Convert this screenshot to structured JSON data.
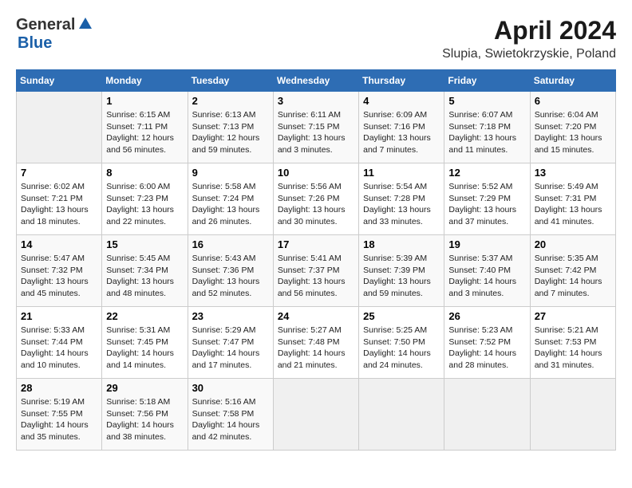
{
  "header": {
    "logo_general": "General",
    "logo_blue": "Blue",
    "title": "April 2024",
    "subtitle": "Slupia, Swietokrzyskie, Poland"
  },
  "calendar": {
    "days_of_week": [
      "Sunday",
      "Monday",
      "Tuesday",
      "Wednesday",
      "Thursday",
      "Friday",
      "Saturday"
    ],
    "weeks": [
      [
        {
          "day": "",
          "info": ""
        },
        {
          "day": "1",
          "info": "Sunrise: 6:15 AM\nSunset: 7:11 PM\nDaylight: 12 hours\nand 56 minutes."
        },
        {
          "day": "2",
          "info": "Sunrise: 6:13 AM\nSunset: 7:13 PM\nDaylight: 12 hours\nand 59 minutes."
        },
        {
          "day": "3",
          "info": "Sunrise: 6:11 AM\nSunset: 7:15 PM\nDaylight: 13 hours\nand 3 minutes."
        },
        {
          "day": "4",
          "info": "Sunrise: 6:09 AM\nSunset: 7:16 PM\nDaylight: 13 hours\nand 7 minutes."
        },
        {
          "day": "5",
          "info": "Sunrise: 6:07 AM\nSunset: 7:18 PM\nDaylight: 13 hours\nand 11 minutes."
        },
        {
          "day": "6",
          "info": "Sunrise: 6:04 AM\nSunset: 7:20 PM\nDaylight: 13 hours\nand 15 minutes."
        }
      ],
      [
        {
          "day": "7",
          "info": "Sunrise: 6:02 AM\nSunset: 7:21 PM\nDaylight: 13 hours\nand 18 minutes."
        },
        {
          "day": "8",
          "info": "Sunrise: 6:00 AM\nSunset: 7:23 PM\nDaylight: 13 hours\nand 22 minutes."
        },
        {
          "day": "9",
          "info": "Sunrise: 5:58 AM\nSunset: 7:24 PM\nDaylight: 13 hours\nand 26 minutes."
        },
        {
          "day": "10",
          "info": "Sunrise: 5:56 AM\nSunset: 7:26 PM\nDaylight: 13 hours\nand 30 minutes."
        },
        {
          "day": "11",
          "info": "Sunrise: 5:54 AM\nSunset: 7:28 PM\nDaylight: 13 hours\nand 33 minutes."
        },
        {
          "day": "12",
          "info": "Sunrise: 5:52 AM\nSunset: 7:29 PM\nDaylight: 13 hours\nand 37 minutes."
        },
        {
          "day": "13",
          "info": "Sunrise: 5:49 AM\nSunset: 7:31 PM\nDaylight: 13 hours\nand 41 minutes."
        }
      ],
      [
        {
          "day": "14",
          "info": "Sunrise: 5:47 AM\nSunset: 7:32 PM\nDaylight: 13 hours\nand 45 minutes."
        },
        {
          "day": "15",
          "info": "Sunrise: 5:45 AM\nSunset: 7:34 PM\nDaylight: 13 hours\nand 48 minutes."
        },
        {
          "day": "16",
          "info": "Sunrise: 5:43 AM\nSunset: 7:36 PM\nDaylight: 13 hours\nand 52 minutes."
        },
        {
          "day": "17",
          "info": "Sunrise: 5:41 AM\nSunset: 7:37 PM\nDaylight: 13 hours\nand 56 minutes."
        },
        {
          "day": "18",
          "info": "Sunrise: 5:39 AM\nSunset: 7:39 PM\nDaylight: 13 hours\nand 59 minutes."
        },
        {
          "day": "19",
          "info": "Sunrise: 5:37 AM\nSunset: 7:40 PM\nDaylight: 14 hours\nand 3 minutes."
        },
        {
          "day": "20",
          "info": "Sunrise: 5:35 AM\nSunset: 7:42 PM\nDaylight: 14 hours\nand 7 minutes."
        }
      ],
      [
        {
          "day": "21",
          "info": "Sunrise: 5:33 AM\nSunset: 7:44 PM\nDaylight: 14 hours\nand 10 minutes."
        },
        {
          "day": "22",
          "info": "Sunrise: 5:31 AM\nSunset: 7:45 PM\nDaylight: 14 hours\nand 14 minutes."
        },
        {
          "day": "23",
          "info": "Sunrise: 5:29 AM\nSunset: 7:47 PM\nDaylight: 14 hours\nand 17 minutes."
        },
        {
          "day": "24",
          "info": "Sunrise: 5:27 AM\nSunset: 7:48 PM\nDaylight: 14 hours\nand 21 minutes."
        },
        {
          "day": "25",
          "info": "Sunrise: 5:25 AM\nSunset: 7:50 PM\nDaylight: 14 hours\nand 24 minutes."
        },
        {
          "day": "26",
          "info": "Sunrise: 5:23 AM\nSunset: 7:52 PM\nDaylight: 14 hours\nand 28 minutes."
        },
        {
          "day": "27",
          "info": "Sunrise: 5:21 AM\nSunset: 7:53 PM\nDaylight: 14 hours\nand 31 minutes."
        }
      ],
      [
        {
          "day": "28",
          "info": "Sunrise: 5:19 AM\nSunset: 7:55 PM\nDaylight: 14 hours\nand 35 minutes."
        },
        {
          "day": "29",
          "info": "Sunrise: 5:18 AM\nSunset: 7:56 PM\nDaylight: 14 hours\nand 38 minutes."
        },
        {
          "day": "30",
          "info": "Sunrise: 5:16 AM\nSunset: 7:58 PM\nDaylight: 14 hours\nand 42 minutes."
        },
        {
          "day": "",
          "info": ""
        },
        {
          "day": "",
          "info": ""
        },
        {
          "day": "",
          "info": ""
        },
        {
          "day": "",
          "info": ""
        }
      ]
    ]
  }
}
